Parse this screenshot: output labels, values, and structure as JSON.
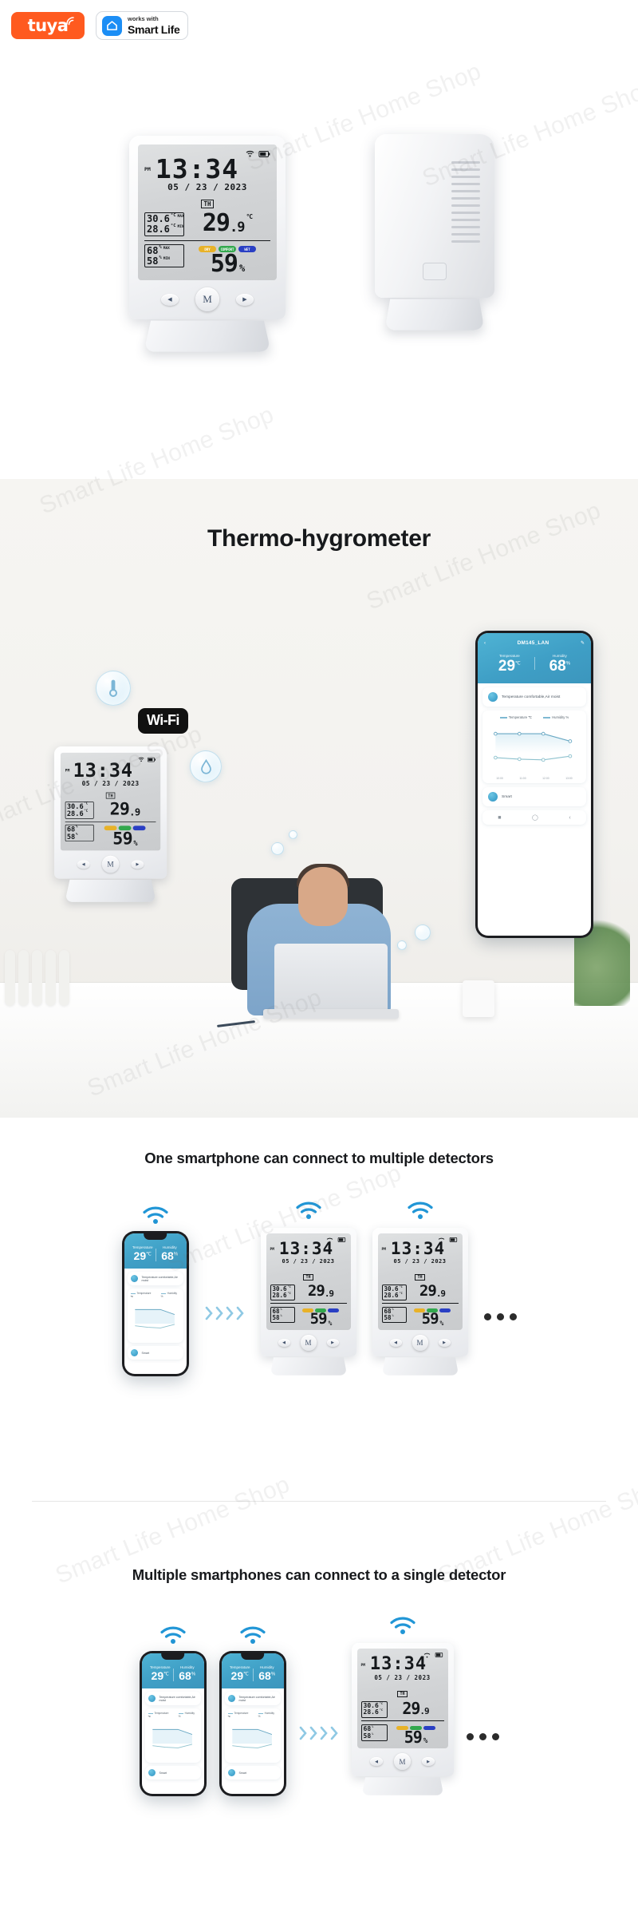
{
  "badges": {
    "tuya_label": "tuya",
    "smartlife_small": "works with",
    "smartlife_large": "Smart Life",
    "tuya_icon": "wifi-arc-icon",
    "smartlife_icon": "home-app-icon"
  },
  "hero": {
    "front_device_alt": "thermo-hygrometer-front-view",
    "back_device_alt": "thermo-hygrometer-back-view"
  },
  "lcd": {
    "pm": "PM",
    "time": "13:34",
    "date": "05 / 23 / 2023",
    "weekday": "TH",
    "wifi_icon": "wifi-icon",
    "battery_icon": "battery-icon",
    "temp_max": "30.6",
    "temp_min": "28.6",
    "temp_unit": "°C",
    "max_label": "MAX",
    "min_label": "MIN",
    "temp_value": "29",
    "temp_decimal": ".9",
    "hum_max": "68",
    "hum_min": "58",
    "hum_unit": "%",
    "hum_value": "59",
    "hum_percent": "%",
    "comfort": [
      "DRY",
      "COMFORT",
      "WET"
    ],
    "comfort_colors": [
      "#e8b229",
      "#33a84e",
      "#2a3fc4"
    ]
  },
  "buttons": {
    "left": "◀",
    "mode": "M",
    "right": "▶",
    "left_name": "prev-button",
    "mode_name": "mode-button",
    "right_name": "next-button"
  },
  "lifestyle": {
    "title": "Thermo-hygrometer",
    "bubble_icons": [
      "thermometer-icon",
      "humidity-drop-icon"
    ],
    "wifi_badge": "Wi-Fi"
  },
  "app": {
    "back_icon": "back-chevron-icon",
    "edit_icon": "edit-pencil-icon",
    "device_name": "DM145_LAN",
    "temp_label": "Temperature",
    "temp_value": "29",
    "temp_unit": "℃",
    "hum_label": "Humidity",
    "hum_value": "68",
    "hum_unit": "%",
    "status_text": "Temperature comfortable,Air moist",
    "legend": [
      "Temperature ℃",
      "Humidity %"
    ],
    "x_labels": [
      "10:00",
      "11:00",
      "12:00",
      "13:00"
    ],
    "smart_label": "Smart",
    "nav_icons": [
      "square-icon",
      "circle-icon",
      "back-icon"
    ]
  },
  "chart_data": {
    "type": "line",
    "title": "",
    "x": [
      "10:00",
      "11:00",
      "12:00",
      "13:00"
    ],
    "series": [
      {
        "name": "Temperature ℃",
        "values": [
          29.0,
          29.0,
          29.0,
          28.0
        ],
        "color": "#7fb9d2"
      },
      {
        "name": "Humidity %",
        "values": [
          67,
          67,
          66,
          67
        ],
        "color": "#8ec2ce"
      }
    ],
    "xlabel": "",
    "ylabel": "",
    "legend_position": "top",
    "grid": false
  },
  "section_multi_detector": {
    "title": "One smartphone can connect to multiple detectors",
    "phone_count": 1,
    "detector_count": 2,
    "arrow_icon": "chevron-right-icon",
    "ellipsis": "• • •"
  },
  "section_multi_phone": {
    "title": "Multiple smartphones can connect to a single detector",
    "phone_count": 2,
    "detector_count": 1,
    "arrow_icon": "chevron-right-icon",
    "ellipsis": "• • •"
  },
  "watermarks": [
    "Smart Life Home Shop",
    "Smart Life Home Shop",
    "Smart Life Home Shop",
    "Smart Life Home Shop",
    "Smart Life Home Shop",
    "Smart Life Home Shop",
    "Smart Life Home Shop"
  ],
  "colors": {
    "tuya_orange": "#ff5a1f",
    "smartlife_blue": "#1c8ef5",
    "app_teal": "#4fb3d4",
    "lcd_gray": "#d2d4d6",
    "comfort_green": "#33a84e"
  }
}
